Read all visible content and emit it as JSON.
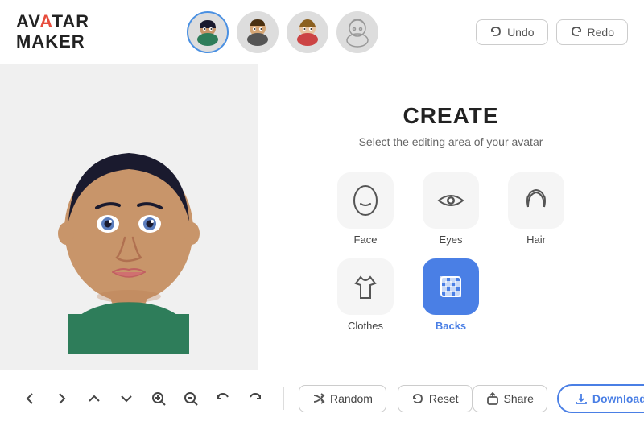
{
  "app": {
    "title": "Avatar Maker",
    "logo_part1": "AV",
    "logo_accent1": "A",
    "logo_part2": "TAR",
    "logo_line2": "MAKER"
  },
  "header": {
    "undo_label": "Undo",
    "redo_label": "Redo",
    "avatar_count": 4
  },
  "create": {
    "title": "CREATE",
    "subtitle": "Select the editing area of your avatar",
    "options": [
      {
        "id": "face",
        "label": "Face",
        "active": false
      },
      {
        "id": "eyes",
        "label": "Eyes",
        "active": false
      },
      {
        "id": "hair",
        "label": "Hair",
        "active": false
      },
      {
        "id": "clothes",
        "label": "Clothes",
        "active": false
      },
      {
        "id": "backs",
        "label": "Backs",
        "active": true
      }
    ]
  },
  "bottom": {
    "random_label": "Random",
    "reset_label": "Reset",
    "share_label": "Share",
    "download_label": "Download"
  }
}
